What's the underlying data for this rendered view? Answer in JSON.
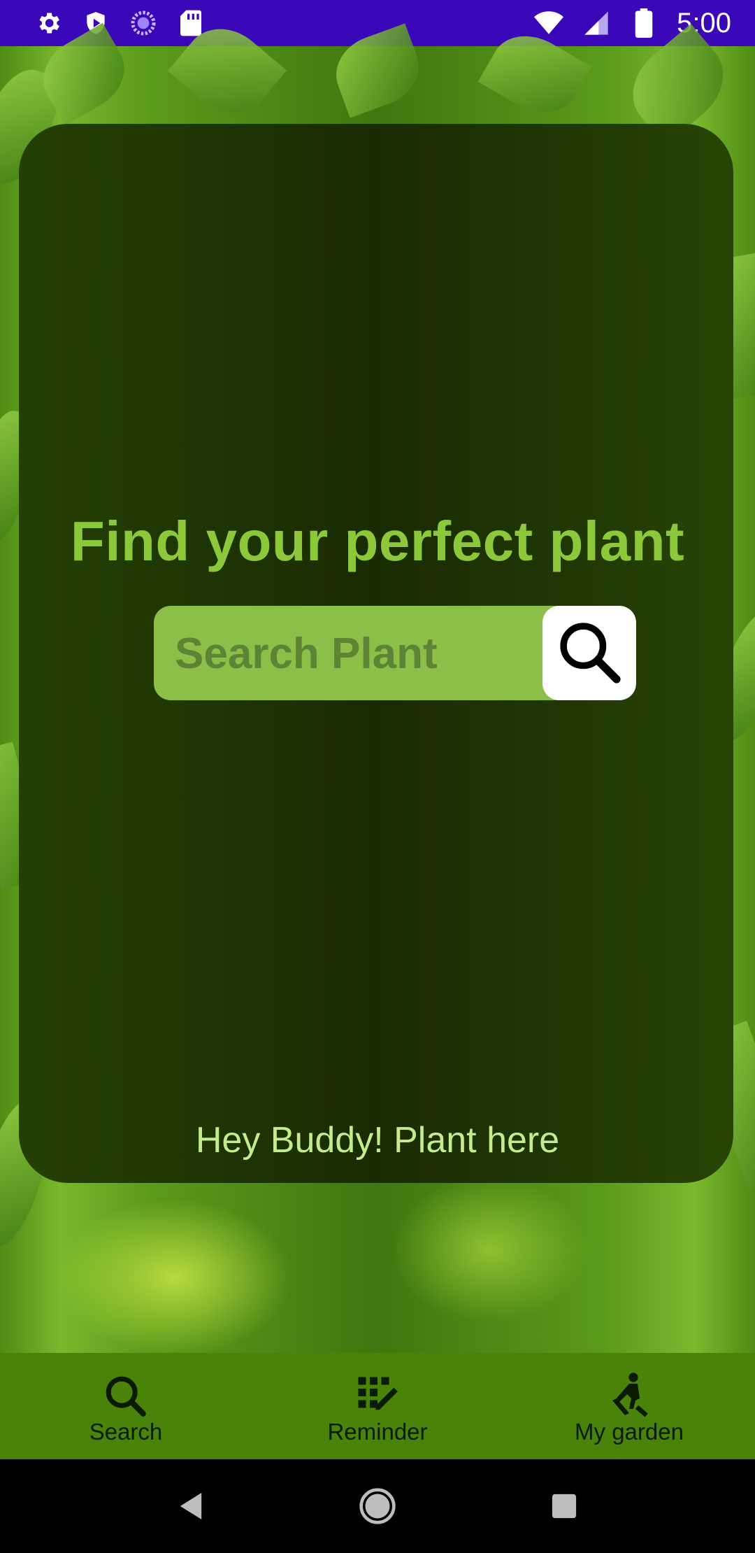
{
  "status_bar": {
    "time": "5:00",
    "left_icons": [
      "gear-icon",
      "shield-play-icon",
      "spinner-icon",
      "sd-card-icon"
    ],
    "right_icons": [
      "wifi-icon",
      "signal-icon",
      "battery-icon"
    ]
  },
  "main": {
    "headline": "Find your perfect plant",
    "search": {
      "placeholder": "Search Plant",
      "value": ""
    },
    "tagline": "Hey Buddy! Plant here"
  },
  "bottom_nav": {
    "items": [
      {
        "label": "Search",
        "icon": "search-icon"
      },
      {
        "label": "Reminder",
        "icon": "calendar-edit-icon"
      },
      {
        "label": "My garden",
        "icon": "gardener-icon"
      }
    ]
  },
  "system_nav": {
    "buttons": [
      "back-icon",
      "home-icon",
      "recents-icon"
    ]
  },
  "colors": {
    "status_bar": "#3a08b8",
    "card": "#1f3503",
    "headline": "#8bc93a",
    "search_field": "#8bbf48",
    "bottom_nav": "#4a830a",
    "tagline": "#c4ec8c"
  }
}
